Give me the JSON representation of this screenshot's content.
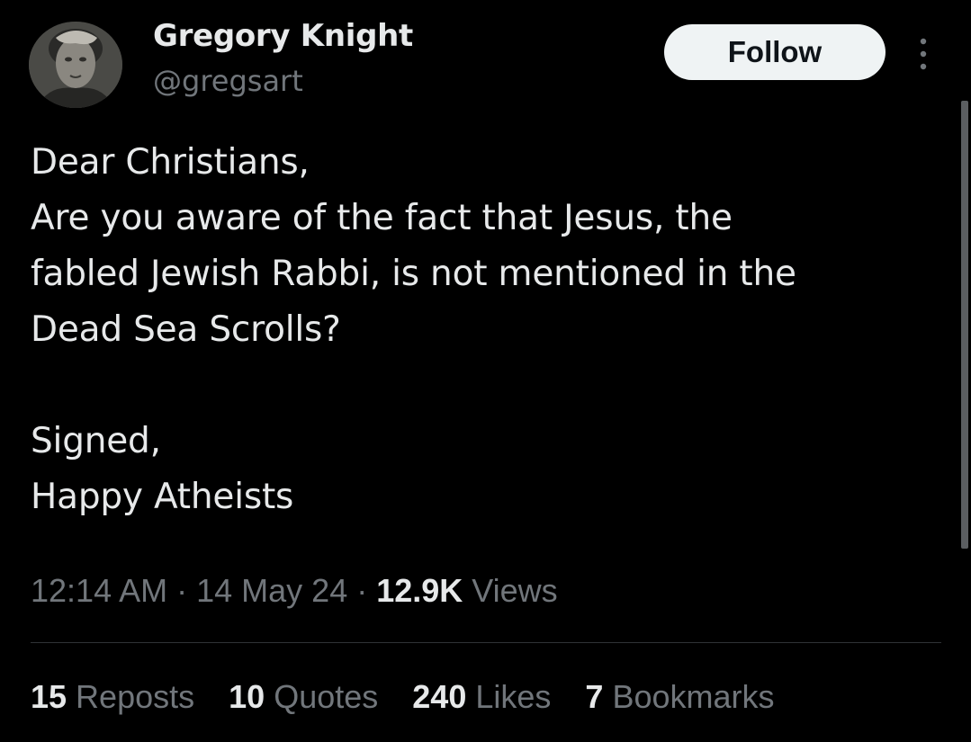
{
  "author": {
    "display_name": "Gregory Knight",
    "handle": "@gregsart",
    "avatar_icon": "profile-photo"
  },
  "actions": {
    "follow_label": "Follow",
    "more_icon": "more-vertical-icon"
  },
  "tweet": {
    "lines": [
      "Dear Christians,",
      "Are you aware of the fact that Jesus, the",
      "fabled Jewish Rabbi, is not mentioned in the",
      "Dead Sea Scrolls?",
      "",
      "Signed,",
      "Happy Atheists"
    ]
  },
  "meta": {
    "time": "12:14 AM",
    "separator": " · ",
    "date": "14 May 24",
    "views_count": "12.9K",
    "views_label": " Views"
  },
  "stats": {
    "reposts": {
      "count": "15",
      "label": " Reposts"
    },
    "quotes": {
      "count": "10",
      "label": " Quotes"
    },
    "likes": {
      "count": "240",
      "label": " Likes"
    },
    "bookmarks": {
      "count": "7",
      "label": " Bookmarks"
    }
  },
  "colors": {
    "background": "#000000",
    "primary_text": "#e7e9ea",
    "secondary_text": "#71767b",
    "follow_button_bg": "#eff3f4",
    "divider": "#2f3336"
  }
}
